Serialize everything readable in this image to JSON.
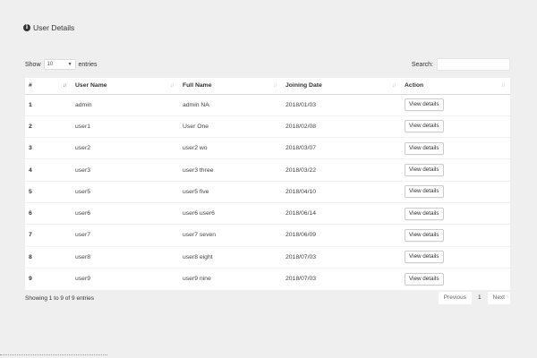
{
  "header": {
    "icon": "info-icon",
    "title": "User Details"
  },
  "controls": {
    "show_label": "Show",
    "page_length": "10",
    "entries_label": "entries",
    "search_label": "Search:",
    "search_value": ""
  },
  "table": {
    "columns": [
      "#",
      "User Name",
      "Full Name",
      "Joining Date",
      "Action"
    ],
    "rows": [
      {
        "num": "1",
        "username": "admin",
        "fullname": "admin NA",
        "date": "2018/01/03",
        "action": "View details"
      },
      {
        "num": "2",
        "username": "user1",
        "fullname": "User One",
        "date": "2018/02/08",
        "action": "View details"
      },
      {
        "num": "3",
        "username": "user2",
        "fullname": "user2 wo",
        "date": "2018/03/07",
        "action": "View details"
      },
      {
        "num": "4",
        "username": "user3",
        "fullname": "user3 three",
        "date": "2018/03/22",
        "action": "View details"
      },
      {
        "num": "5",
        "username": "user5",
        "fullname": "user5 five",
        "date": "2018/04/10",
        "action": "View details"
      },
      {
        "num": "6",
        "username": "user6",
        "fullname": "user6 user6",
        "date": "2018/06/14",
        "action": "View details"
      },
      {
        "num": "7",
        "username": "user7",
        "fullname": "user7 seven",
        "date": "2018/06/09",
        "action": "View details"
      },
      {
        "num": "8",
        "username": "user8",
        "fullname": "user8 eight",
        "date": "2018/07/03",
        "action": "View details"
      },
      {
        "num": "9",
        "username": "user9",
        "fullname": "user9 nine",
        "date": "2018/07/03",
        "action": "View details"
      }
    ]
  },
  "footer": {
    "info": "Showing 1 to 9 of 9 entries",
    "previous": "Previous",
    "current_page": "1",
    "next": "Next"
  }
}
